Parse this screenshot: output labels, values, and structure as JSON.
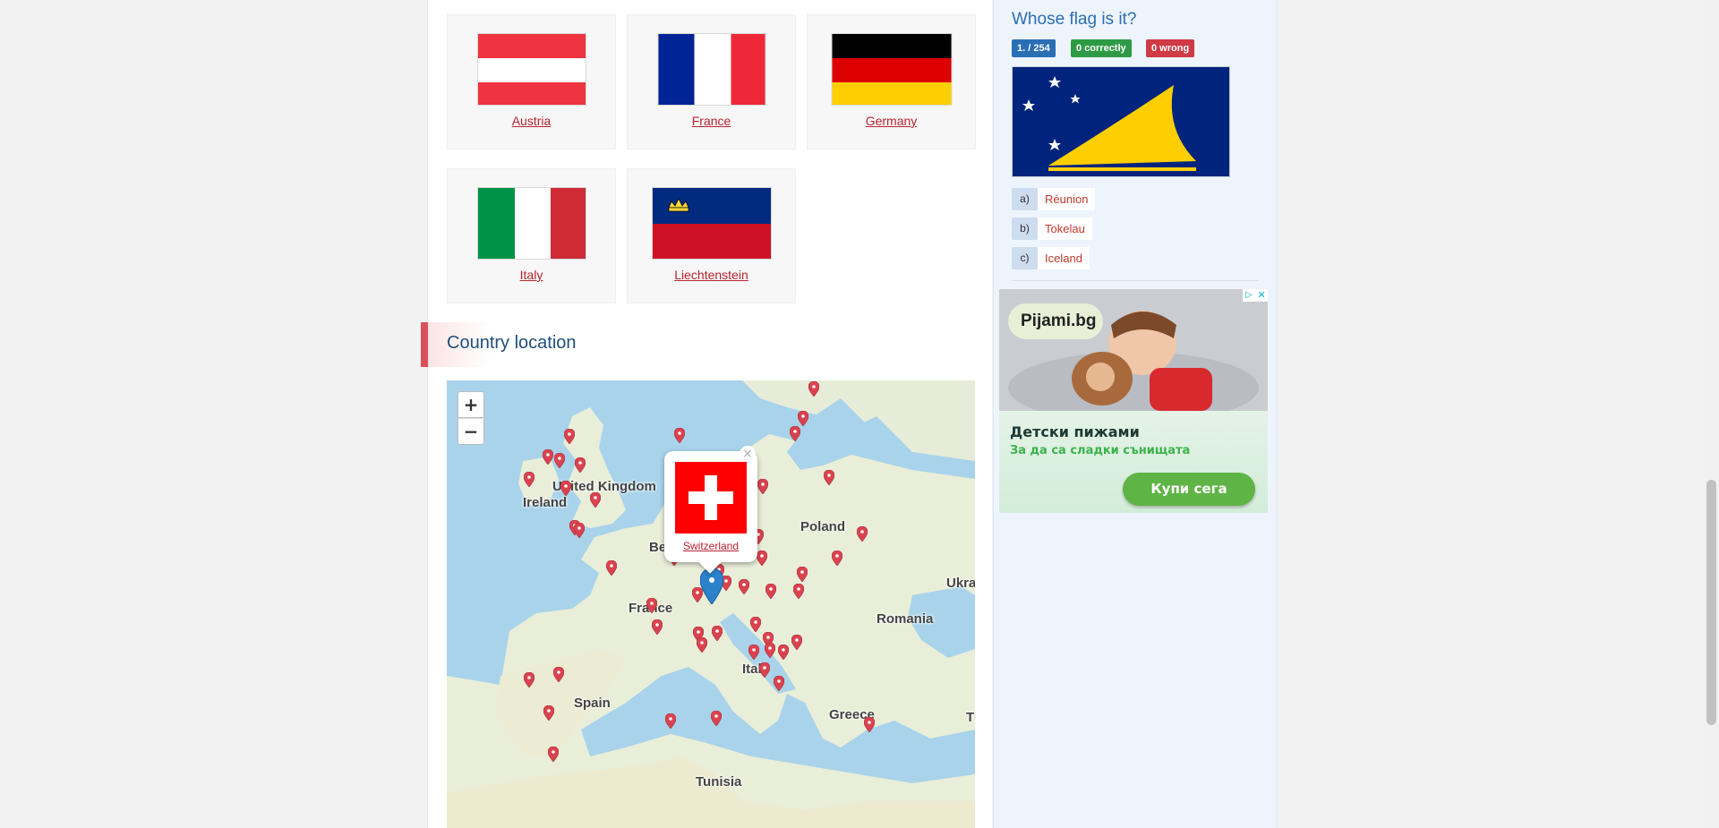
{
  "flags": {
    "items": [
      {
        "name": "Austria"
      },
      {
        "name": "France"
      },
      {
        "name": "Germany"
      },
      {
        "name": "Italy"
      },
      {
        "name": "Liechtenstein"
      }
    ]
  },
  "section": {
    "title": "Country location"
  },
  "map": {
    "zoom_in": "+",
    "zoom_out": "−",
    "labels": [
      "United Kingdom",
      "Ireland",
      "Be",
      "Poland",
      "France",
      "Romania",
      "Ukra",
      "Italy",
      "Spain",
      "Greece",
      "Tunisia",
      "T"
    ],
    "popup": {
      "country": "Switzerland",
      "close": "×"
    }
  },
  "quiz": {
    "title": "Whose flag is it?",
    "counter": "1. / 254",
    "correct": "0  correctly",
    "wrong": "0  wrong",
    "answers": [
      {
        "letter": "a)",
        "text": "Réunion"
      },
      {
        "letter": "b)",
        "text": "Tokelau"
      },
      {
        "letter": "c)",
        "text": "Iceland"
      }
    ]
  },
  "ad": {
    "brand": "Pijami.bg",
    "headline": "Детски пижами",
    "subline": "За да са сладки сънищата",
    "cta": "Купи сега",
    "info": "▷",
    "close": "✕"
  },
  "colors": {
    "link_red": "#b8232f",
    "accent_blue": "#2a6fb5",
    "correct_green": "#2f9a45",
    "wrong_red": "#cf3a45",
    "pin_red": "#d9434f",
    "pin_blue": "#2b82cb"
  }
}
